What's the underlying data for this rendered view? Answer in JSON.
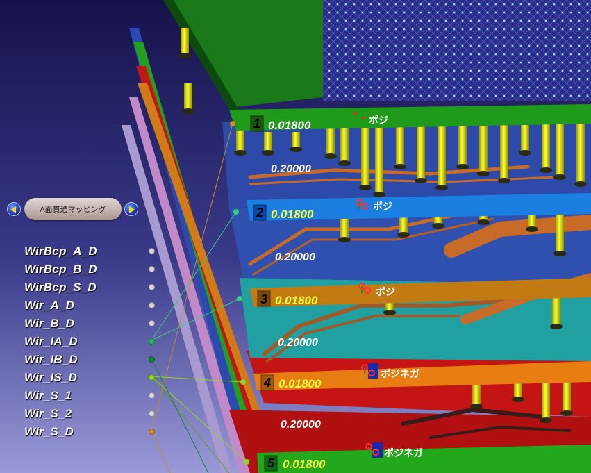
{
  "mapping_control": {
    "label": "A面貫通マッピング",
    "prev_icon": "arrow-left-icon",
    "next_icon": "arrow-right-icon"
  },
  "layer_list": [
    {
      "name": "WirBcp_A_D",
      "color": "#d9d9d9"
    },
    {
      "name": "WirBcp_B_D",
      "color": "#d9d9d9"
    },
    {
      "name": "WirBcp_S_D",
      "color": "#d9d9d9"
    },
    {
      "name": "Wir_A_D",
      "color": "#d9d9d9"
    },
    {
      "name": "Wir_B_D",
      "color": "#d9d9d9"
    },
    {
      "name": "Wir_IA_D",
      "color": "#22c05a"
    },
    {
      "name": "Wir_IB_D",
      "color": "#0e8a2a"
    },
    {
      "name": "Wir_IS_D",
      "color": "#8fd81a"
    },
    {
      "name": "Wir_S_1",
      "color": "#d9d9d9"
    },
    {
      "name": "Wir_S_2",
      "color": "#d9d9d9"
    },
    {
      "name": "Wir_S_D",
      "color": "#d98a1a"
    }
  ],
  "layers": [
    {
      "number": "1",
      "thickness": "0.01800",
      "polarity": "ポジ",
      "color": "#1f9a1a"
    },
    {
      "number": "2",
      "thickness": "0.01800",
      "polarity": "ポジ",
      "color": "#1a7fe0"
    },
    {
      "number": "3",
      "thickness": "0.01800",
      "polarity": "ポジ",
      "color": "#c27a12"
    },
    {
      "number": "4",
      "thickness": "0.01800",
      "polarity": "ポジネガ",
      "color": "#e87d12"
    },
    {
      "number": "5",
      "thickness": "0.01800",
      "polarity": "ポジネガ",
      "color": "#22a81a"
    }
  ],
  "dielectrics": [
    {
      "thickness": "0.20000"
    },
    {
      "thickness": "0.20000"
    },
    {
      "thickness": "0.20000"
    },
    {
      "thickness": "0.20000"
    }
  ]
}
